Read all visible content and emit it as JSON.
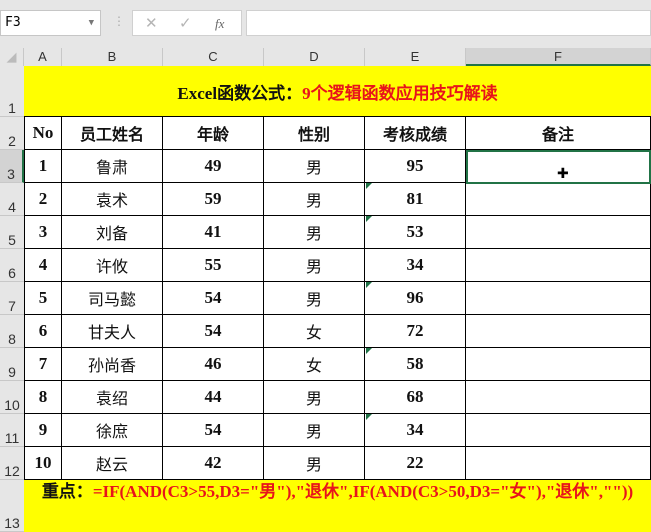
{
  "formula_bar": {
    "name_box": "F3",
    "cancel": "✕",
    "enter": "✓",
    "fx": "fx",
    "formula": ""
  },
  "columns": [
    "A",
    "B",
    "C",
    "D",
    "E",
    "F"
  ],
  "rows": [
    "1",
    "2",
    "3",
    "4",
    "5",
    "6",
    "7",
    "8",
    "9",
    "10",
    "11",
    "12",
    "13"
  ],
  "title": {
    "black": "Excel函数公式：",
    "red": "9个逻辑函数应用技巧解读"
  },
  "headers": [
    "No",
    "员工姓名",
    "年龄",
    "性别",
    "考核成绩",
    "备注"
  ],
  "data": [
    [
      "1",
      "鲁肃",
      "49",
      "男",
      "95",
      ""
    ],
    [
      "2",
      "袁术",
      "59",
      "男",
      "81",
      ""
    ],
    [
      "3",
      "刘备",
      "41",
      "男",
      "53",
      ""
    ],
    [
      "4",
      "许攸",
      "55",
      "男",
      "34",
      ""
    ],
    [
      "5",
      "司马懿",
      "54",
      "男",
      "96",
      ""
    ],
    [
      "6",
      "甘夫人",
      "54",
      "女",
      "72",
      ""
    ],
    [
      "7",
      "孙尚香",
      "46",
      "女",
      "58",
      ""
    ],
    [
      "8",
      "袁绍",
      "44",
      "男",
      "68",
      ""
    ],
    [
      "9",
      "徐庶",
      "54",
      "男",
      "34",
      ""
    ],
    [
      "10",
      "赵云",
      "42",
      "男",
      "22",
      ""
    ]
  ],
  "note": {
    "label": "重点：",
    "formula": "=IF(AND(C3>55,D3=\"男\"),\"退休\",IF(AND(C3>50,D3=\"女\"),\"退休\",\"\"))"
  },
  "colors": {
    "yellow": "#ffff00",
    "red": "#e8131b",
    "select": "#217346"
  }
}
